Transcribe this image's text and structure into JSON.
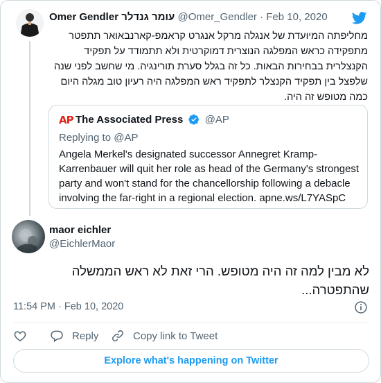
{
  "tweet_a": {
    "display_name": "Omer Gendler עומר גנדלר",
    "handle": "@Omer_Gendler",
    "separator": "·",
    "date": "Feb 10, 2020",
    "text": "מחליפתה המיועדת של אנגלה מרקל אנגרט קראמפ-קארנבאואר תתפטר מתפקידה כראש המפלגה הנוצרית דמוקרטית ולא תתמודד על תפקיד הקנצלרית בבחירות הבאות. כל זה בגלל סערת תורינגיה. מי שחשב לפני שנה שלפצל בין תפקיד הקנצלר לתפקיד ראש המפלגה היה רעיון טוב מגלה היום כמה מטופש זה היה."
  },
  "quoted": {
    "logo": "AP",
    "display_name": "The Associated Press",
    "handle": "@AP",
    "replying_to": "Replying to @AP",
    "text": "Angela Merkel's designated successor Annegret Kramp-Karrenbauer will quit her role as head of the Germany's strongest party and won't stand for the chancellorship following a debacle involving the far-right in a regional election. apne.ws/L7YASpC"
  },
  "tweet_b": {
    "display_name": "maor eichler",
    "handle": "@EichlerMaor",
    "text": "לא מבין למה זה היה מטופש. הרי זאת לא ראש הממשלה שהתפטרה...",
    "timestamp": "11:54 PM · Feb 10, 2020"
  },
  "actions": {
    "reply_label": "Reply",
    "copy_link_label": "Copy link to Tweet"
  },
  "explore_label": "Explore what's happening on Twitter",
  "colors": {
    "brand_blue": "#1d9bf0",
    "ap_red": "#e2231a",
    "secondary_text": "#536471",
    "border": "#cfd9de"
  },
  "icons": {
    "brand": "twitter-bird-icon",
    "verified": "verified-badge-icon",
    "info": "info-icon",
    "like": "heart-icon",
    "reply": "reply-bubble-icon",
    "copy_link": "link-icon"
  }
}
